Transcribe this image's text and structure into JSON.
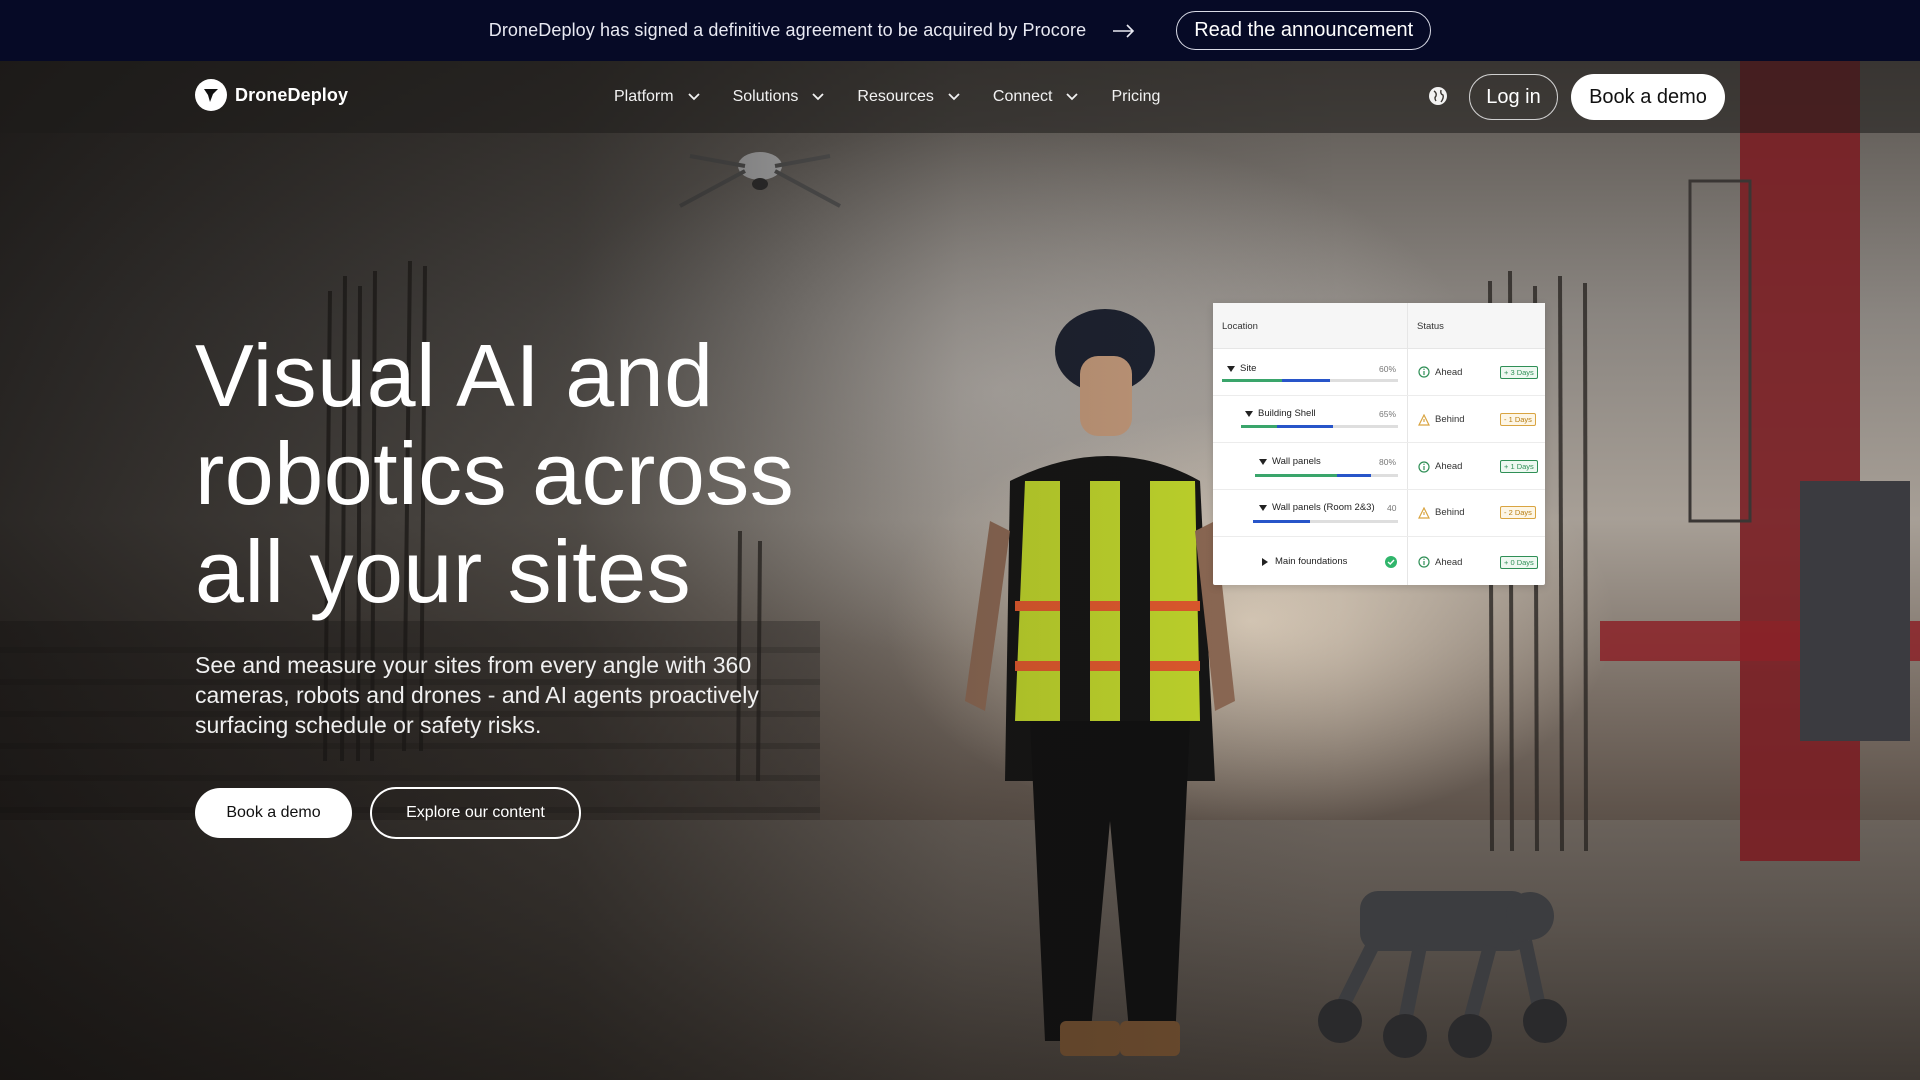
{
  "announcement": {
    "text": "DroneDeploy has signed a definitive agreement to be acquired by Procore",
    "button_label": "Read the announcement"
  },
  "nav": {
    "brand": "DroneDeploy",
    "items": [
      {
        "label": "Platform",
        "has_dropdown": true
      },
      {
        "label": "Solutions",
        "has_dropdown": true
      },
      {
        "label": "Resources",
        "has_dropdown": true
      },
      {
        "label": "Connect",
        "has_dropdown": true
      },
      {
        "label": "Pricing",
        "has_dropdown": false
      }
    ],
    "login_label": "Log in",
    "demo_label": "Book a demo"
  },
  "hero": {
    "title": "Visual AI and robotics across all your sites",
    "subtitle": "See and measure your sites from every angle with 360 cameras, robots and drones - and AI agents proactively surfacing schedule or safety risks.",
    "primary_cta": "Book a demo",
    "secondary_cta": "Explore our content"
  },
  "status_panel": {
    "col_location": "Location",
    "col_status": "Status",
    "rows": [
      {
        "label": "Site",
        "pct": "60%",
        "status": "Ahead",
        "badge": "+ 3 Days",
        "tone": "good"
      },
      {
        "label": "Building Shell",
        "pct": "65%",
        "status": "Behind",
        "badge": "- 1 Days",
        "tone": "bad"
      },
      {
        "label": "Wall panels",
        "pct": "80%",
        "status": "Ahead",
        "badge": "+ 1 Days",
        "tone": "good"
      },
      {
        "label": "Wall panels (Room 2&3)",
        "pct": "40",
        "status": "Behind",
        "badge": "- 2 Days",
        "tone": "bad"
      },
      {
        "label": "Main foundations",
        "pct": "",
        "status": "Ahead",
        "badge": "+ 0 Days",
        "tone": "good"
      }
    ]
  },
  "colors": {
    "announcement_bg": "#060a26",
    "good": "#2f8f56",
    "bad": "#d9a441",
    "progress_blue": "#2855c9",
    "progress_green": "#3aa56b"
  }
}
